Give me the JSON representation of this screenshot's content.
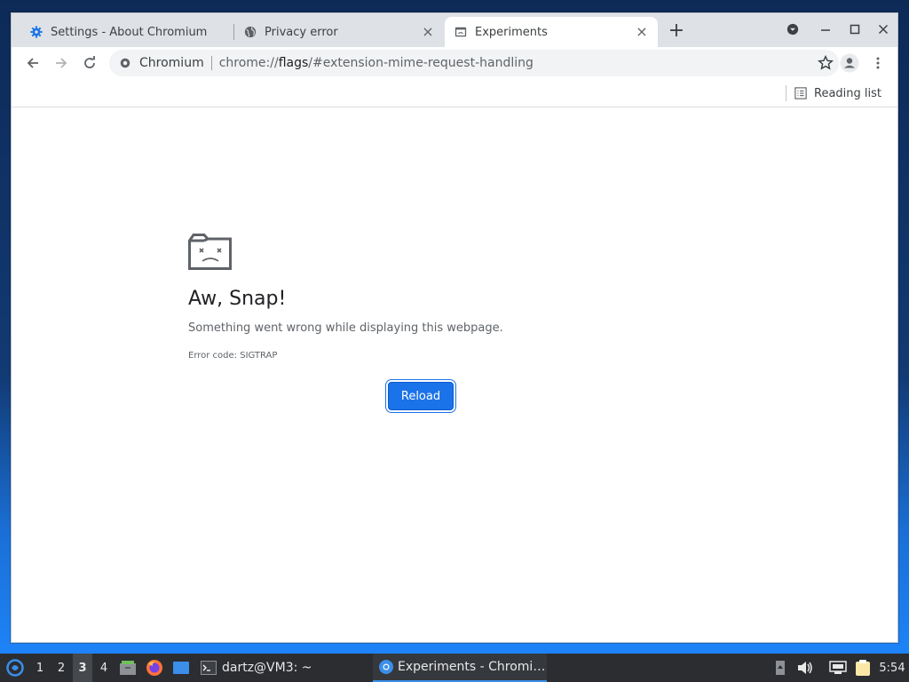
{
  "browser": {
    "tabs": [
      {
        "title": "Settings - About Chromium",
        "icon": "gear-icon",
        "active": false
      },
      {
        "title": "Privacy error",
        "icon": "globe-icon",
        "active": false
      },
      {
        "title": "Experiments",
        "icon": "experiments-icon",
        "active": true
      }
    ],
    "omnibox": {
      "site_label": "Chromium",
      "url_prefix": "chrome://",
      "url_host": "flags",
      "url_suffix": "/#extension-mime-request-handling"
    },
    "bookmarks_bar": {
      "reading_list_label": "Reading list"
    }
  },
  "error_page": {
    "title": "Aw, Snap!",
    "message": "Something went wrong while displaying this webpage.",
    "error_code": "Error code: SIGTRAP",
    "reload_label": "Reload"
  },
  "taskbar": {
    "workspaces": [
      "1",
      "2",
      "3",
      "4"
    ],
    "active_workspace": "3",
    "terminal_task": "dartz@VM3: ~",
    "browser_task": "Experiments - Chromi…",
    "clock": "5:54"
  },
  "colors": {
    "accent": "#1a73e8",
    "tabstrip": "#dee1e6",
    "taskbar": "#2b2d31"
  }
}
